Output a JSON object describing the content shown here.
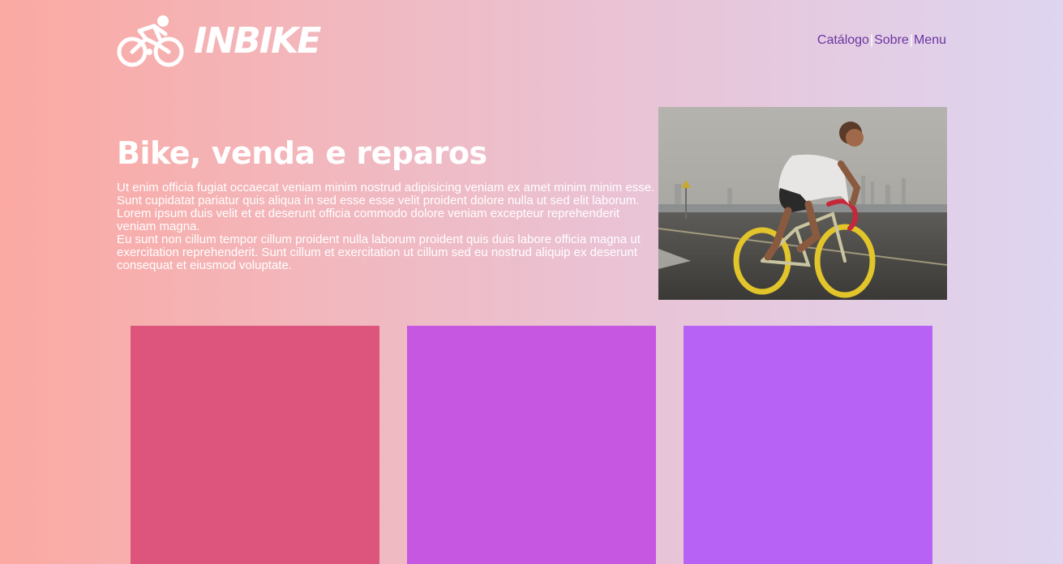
{
  "brand": {
    "name": "INBIKE",
    "logo_icon": "cyclist-icon"
  },
  "nav": {
    "items": [
      {
        "label": "Catálogo"
      },
      {
        "label": "Sobre"
      },
      {
        "label": "Menu"
      }
    ],
    "separator": "|"
  },
  "hero": {
    "title": "Bike, venda e reparos",
    "paragraphs": [
      "Ut enim officia fugiat occaecat veniam minim nostrud adipisicing veniam ex amet minim minim esse. Sunt cupidatat pariatur quis aliqua in sed esse esse velit proident dolore nulla ut sed elit laborum. Lorem ipsum duis velit et et deserunt officia commodo dolore veniam excepteur reprehenderit veniam magna.",
      "Eu sunt non cillum tempor cillum proident nulla laborum proident quis duis labore officia magna ut exercitation reprehenderit. Sunt cillum et exercitation ut cillum sed eu nostrud aliquip ex deserunt consequat et eiusmod voluptate."
    ],
    "image_icon": "cyclist-photo"
  },
  "cards": [
    {
      "color": "#dd557d"
    },
    {
      "color": "#c657e1"
    },
    {
      "color": "#b762f5"
    }
  ],
  "colors": {
    "nav_link": "#6b35a0",
    "bg_left": "#fba9a2",
    "bg_right": "#ded5f0"
  }
}
